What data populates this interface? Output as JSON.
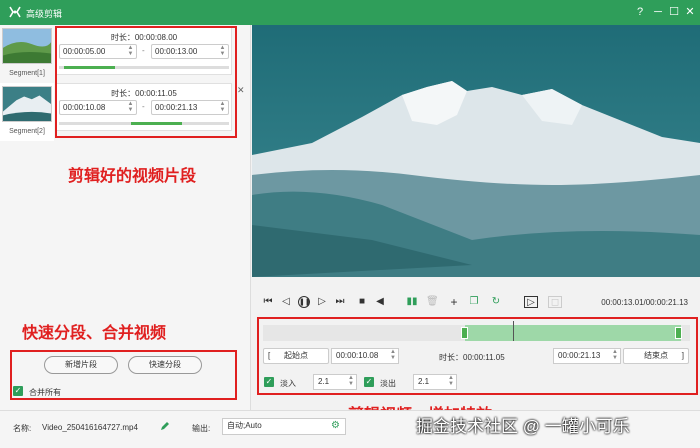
{
  "app": {
    "title": "高级剪辑",
    "accent": "#2f9e5a"
  },
  "window_controls": {
    "help": "?",
    "minimize": "─",
    "maximize": "☐",
    "close": "✕"
  },
  "thumbnails": [
    {
      "label": "Segment[1]"
    },
    {
      "label": "Segment[2]"
    }
  ],
  "segments": [
    {
      "duration": "时长：00:00:08.00",
      "start": "00:00:05.00",
      "end": "00:00:13.00",
      "separator": "-",
      "progress": 0.55
    },
    {
      "duration": "时长：00:00:11.05",
      "start": "00:00:10.08",
      "end": "00:00:21.13",
      "separator": "-",
      "progress": 0.55
    }
  ],
  "annotations": {
    "segments": "剪辑好的视频片段",
    "split_merge": "快速分段、合并视频",
    "edit_effects": "剪辑视频，增加特效"
  },
  "left_actions": {
    "new_segment": "新增片段",
    "quick_split": "快速分段",
    "merge_all": "合并所有"
  },
  "player": {
    "timecode": "00:00:13.01/00:00:21.13"
  },
  "trim": {
    "start_button": "起始点",
    "start_time": "00:00:10.08",
    "duration": "时长：00:00:11.05",
    "end_time": "00:00:21.13",
    "end_button": "结束点",
    "bracket_left": "[",
    "bracket_right": "]",
    "fade_in_label": "淡入",
    "fade_in_value": "2.1",
    "fade_out_label": "淡出",
    "fade_out_value": "2.1"
  },
  "footer": {
    "name_label": "名称:",
    "name_value": "Video_250416164727.mp4",
    "output_label": "输出:",
    "output_value": "自动;Auto"
  },
  "watermark": "掘金技术社区 @ 一罐小可乐"
}
